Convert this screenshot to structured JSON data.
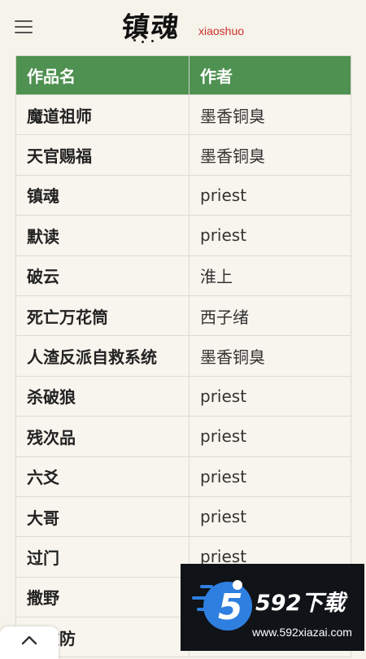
{
  "header": {
    "menu_icon": "hamburger-menu-icon",
    "logo_cn": "镇魂",
    "logo_en": "xiaoshuo"
  },
  "table": {
    "columns": [
      "作品名",
      "作者"
    ],
    "rows": [
      {
        "title": "魔道祖师",
        "author": "墨香铜臭"
      },
      {
        "title": "天官赐福",
        "author": "墨香铜臭"
      },
      {
        "title": "镇魂",
        "author": "priest"
      },
      {
        "title": "默读",
        "author": "priest"
      },
      {
        "title": "破云",
        "author": "淮上"
      },
      {
        "title": "死亡万花筒",
        "author": "西子绪"
      },
      {
        "title": "人渣反派自救系统",
        "author": "墨香铜臭"
      },
      {
        "title": "杀破狼",
        "author": "priest"
      },
      {
        "title": "残次品",
        "author": "priest"
      },
      {
        "title": "六爻",
        "author": "priest"
      },
      {
        "title": "大哥",
        "author": "priest"
      },
      {
        "title": "过门",
        "author": "priest"
      },
      {
        "title": "撒野",
        "author": ""
      },
      {
        "title": "骨攻防",
        "author": ""
      }
    ]
  },
  "back_to_top": {
    "icon": "chevron-up-icon"
  },
  "watermark": {
    "brand": "592下载",
    "url": "www.592xiazai.com"
  },
  "colors": {
    "header_green": "#4e9150",
    "background": "#f5f3ea",
    "logo_red": "#d0302a",
    "watermark_blue": "#2e7fe0"
  }
}
